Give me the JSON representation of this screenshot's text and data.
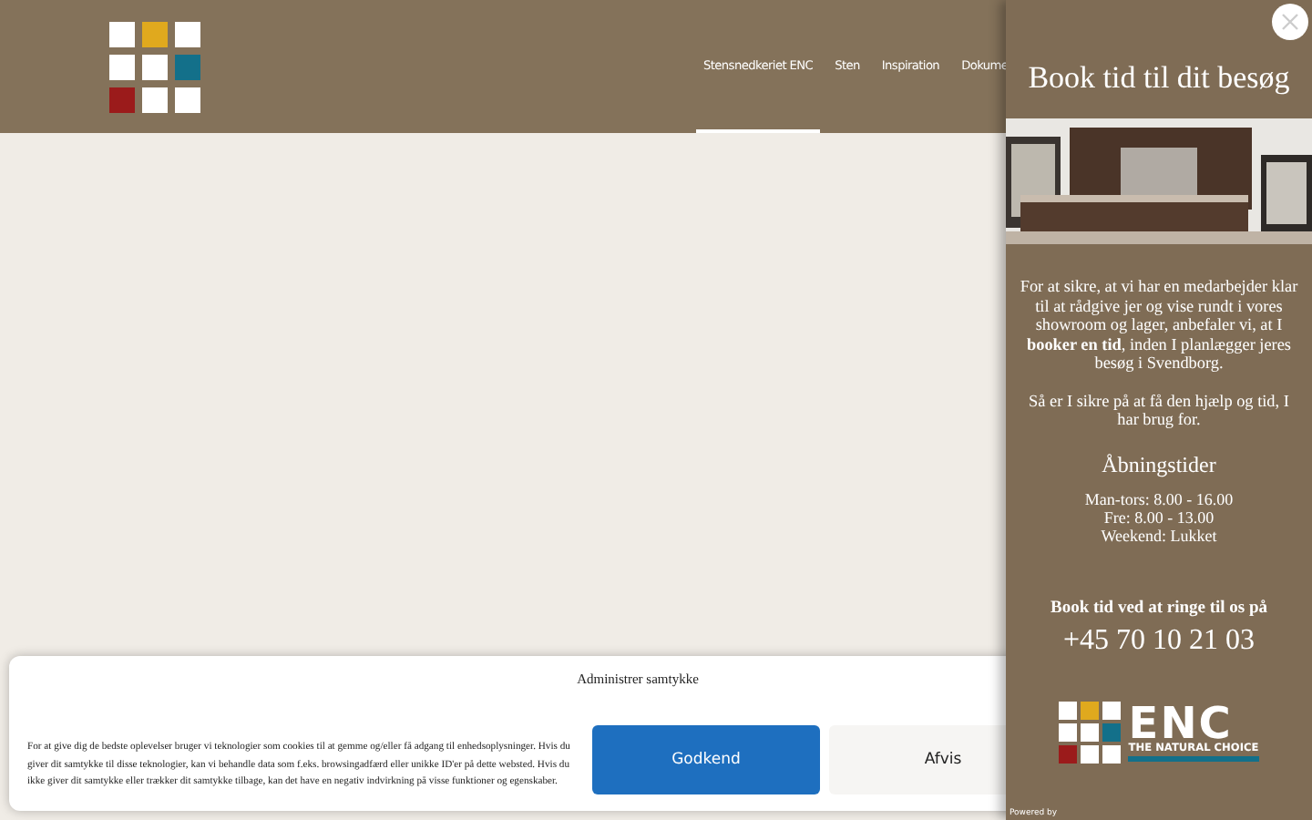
{
  "header": {
    "nav": [
      {
        "label": "Stensnedkeriet ENC",
        "selected": true
      },
      {
        "label": "Sten",
        "selected": false
      },
      {
        "label": "Inspiration",
        "selected": false
      },
      {
        "label": "Dokume",
        "selected": false
      }
    ]
  },
  "popup": {
    "title": "Book tid til dit besøg",
    "image": {
      "kind": "picture"
    },
    "intro": "For at sikre, at vi har en medarbejder klar til at rådgive jer og vise rundt i vores showroom og lager, anbefaler vi, at I **booker en tid**, inden I planlægger jeres besøg i Svendborg.",
    "help": "Så er I sikre på at få den hjælp og tid, I har brug for.",
    "hours_title": "Åbningstider",
    "hours": [
      "Man-tors: 8.00 - 16.00",
      "Fre: 8.00 - 13.00",
      "Weekend: Lukket"
    ],
    "call_label": "Book tid ved at ringe til os på",
    "phone": "+45 70 10 21 03",
    "logo": {
      "name": "ENC",
      "tagline": "THE NATURAL CHOICE"
    },
    "powered_by": "Powered by"
  },
  "cookie_banner": {
    "title": "Administrer samtykke",
    "text": "For at give dig de bedste oplevelser bruger vi teknologier som cookies til at gemme og/eller få adgang til enhedsoplysninger. Hvis du giver dit samtykke til disse teknologier, kan vi behandle data som f.eks. browsingadfærd eller unikke ID'er på dette websted. Hvis du ikke giver dit samtykke eller trækker dit samtykke tilbage, kan det have en negativ indvirkning på visse funktioner og egenskaber.",
    "buttons": [
      {
        "label": "Godkend",
        "kind": "primary"
      },
      {
        "label": "Afvis",
        "kind": "secondary"
      }
    ]
  }
}
